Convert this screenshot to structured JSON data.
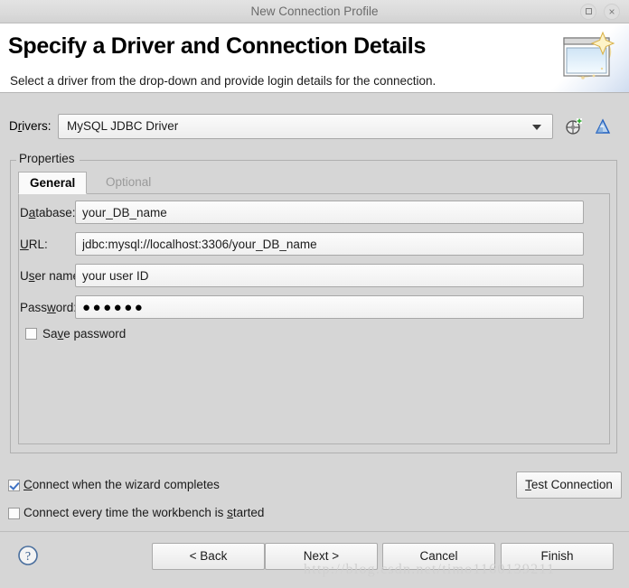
{
  "window": {
    "title": "New Connection Profile",
    "maximize_label": "Maximize",
    "close_label": "×"
  },
  "header": {
    "title": "Specify a Driver and Connection Details",
    "subtitle": "Select a driver from the drop-down and provide login details for the connection.",
    "banner_icon": "new-wizard-banner-icon"
  },
  "drivers": {
    "label_pre": "D",
    "label_mnemonic": "r",
    "label_post": "ivers:",
    "selected": "MySQL JDBC Driver",
    "new_driver_icon": "new-driver-icon",
    "edit_driver_icon": "edit-driver-icon"
  },
  "properties": {
    "group_label": "Properties",
    "tabs": [
      {
        "label": "General",
        "mnemonic_index": 1,
        "active": true
      },
      {
        "label": "Optional",
        "mnemonic_index": 1,
        "active": false
      }
    ],
    "fields": [
      {
        "name": "database",
        "label_pre": "D",
        "label_mn": "a",
        "label_post": "tabase:",
        "value": "your_DB_name",
        "placeholder": ""
      },
      {
        "name": "url",
        "label_pre": "",
        "label_mn": "U",
        "label_post": "RL:",
        "value": "jdbc:mysql://localhost:3306/your_DB_name",
        "placeholder": ""
      },
      {
        "name": "username",
        "label_pre": "U",
        "label_mn": "s",
        "label_post": "er name:",
        "value": "your user ID",
        "placeholder": ""
      },
      {
        "name": "password",
        "label_pre": "Pass",
        "label_mn": "w",
        "label_post": "ord:",
        "value": "●●●●●●",
        "placeholder": ""
      }
    ],
    "save_password": {
      "label_pre": "Sa",
      "label_mn": "v",
      "label_post": "e password",
      "checked": false
    }
  },
  "options": {
    "connect_on_complete": {
      "label_pre": "",
      "label_mn": "C",
      "label_post": "onnect when the wizard completes",
      "checked": true
    },
    "connect_on_startup": {
      "label_pre": "Connect every time the workbench is ",
      "label_mn": "s",
      "label_post": "tarted",
      "checked": false
    },
    "test_connection": {
      "label_pre": "",
      "label_mn": "T",
      "label_post": "est Connection"
    }
  },
  "footer": {
    "help_icon": "help-icon",
    "buttons": [
      {
        "name": "back",
        "label": "< Back"
      },
      {
        "name": "next",
        "label": "Next >"
      },
      {
        "name": "cancel",
        "label": "Cancel"
      },
      {
        "name": "finish",
        "label": "Finish"
      }
    ]
  },
  "watermark": "http://blog.csdn.net/timo1160139211",
  "colors": {
    "dialog_bg": "#d6d6d6",
    "header_bg": "#ffffff",
    "accent_check": "#3f72c4",
    "tab_inactive_text": "#9a9a9a",
    "edit_driver_blue": "#1f5fbf"
  }
}
